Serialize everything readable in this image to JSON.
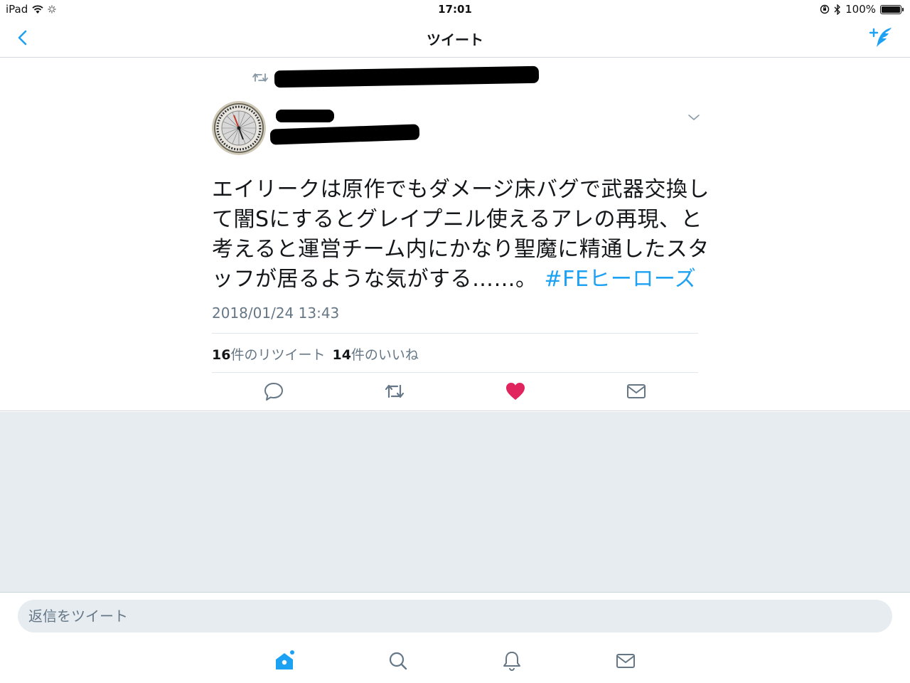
{
  "status_bar": {
    "device": "iPad",
    "time": "17:01",
    "battery": "100%",
    "battery_level": 1.0
  },
  "nav": {
    "title": "ツイート",
    "back_icon": "chevron-left-icon",
    "compose_icon": "compose-tweet-icon"
  },
  "tweet": {
    "body": "エイリークは原作でもダメージ床バグで武器交換して闇Sにするとグレイプニル使えるアレの再現、と考えると運営チーム内にかなり聖魔に精通したスタッフが居るような気がする……。",
    "hashtag": "#FEヒーローズ",
    "timestamp": "2018/01/24 13:43",
    "retweet_count": "16",
    "retweet_label": "件のリツイート",
    "like_count": "14",
    "like_label": "件のいいね",
    "liked": true
  },
  "reply": {
    "placeholder": "返信をツイート"
  },
  "tabs": [
    "home-icon",
    "search-icon",
    "notifications-icon",
    "messages-icon"
  ],
  "colors": {
    "accent": "#1da1f2",
    "like": "#e0245e",
    "secondary_text": "#657786",
    "background_gray": "#e6ecf0"
  }
}
